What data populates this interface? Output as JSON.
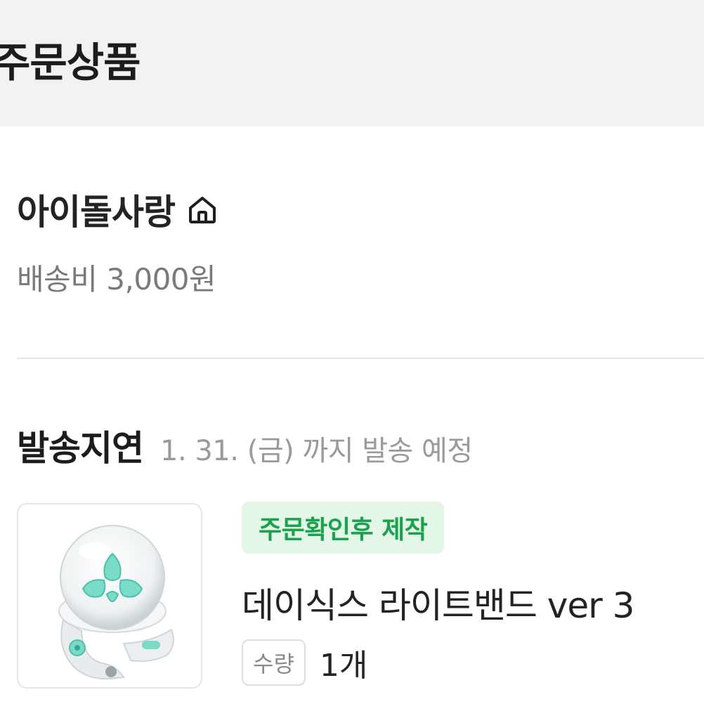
{
  "header": {
    "title": "주문상품"
  },
  "seller": {
    "name": "아이돌사랑",
    "home_icon": "home-icon",
    "shipping_fee": "배송비 3,000원"
  },
  "shipment": {
    "status": "발송지연",
    "expected": "1. 31. (금) 까지 발송 예정"
  },
  "product": {
    "badge": "주문확인후 제작",
    "name": "데이식스 라이트밴드 ver 3",
    "quantity_label": "수량",
    "quantity_value": "1개",
    "image_icon": "lightband-product-image"
  },
  "colors": {
    "header_bg": "#f2f2f4",
    "badge_bg": "#e3f6e8",
    "badge_text": "#1aa24c",
    "muted_text": "#7a7a7a",
    "divider": "#e6e6e8"
  }
}
